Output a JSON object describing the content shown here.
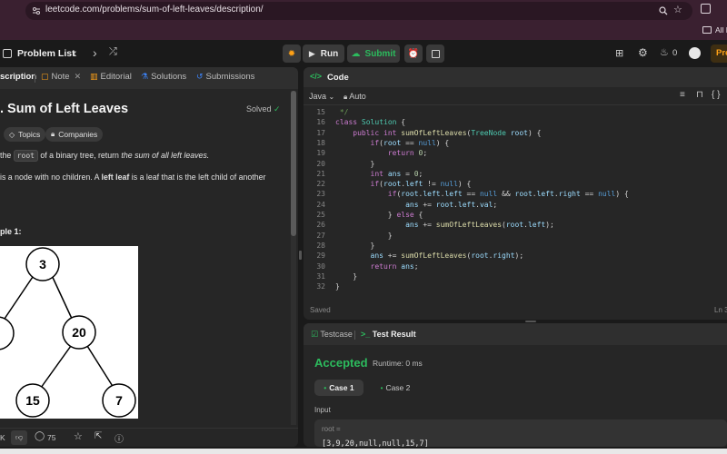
{
  "browser": {
    "url": "leetcode.com/problems/sum-of-left-leaves/description/",
    "bookmarks_label": "All B"
  },
  "nav": {
    "problem_list": "Problem List",
    "run": "Run",
    "submit": "Submit",
    "streak": "0",
    "premium": "Pre"
  },
  "left_tabs": {
    "description": "scription",
    "note": "Note",
    "editorial": "Editorial",
    "solutions": "Solutions",
    "submissions": "Submissions"
  },
  "problem": {
    "title": ". Sum of Left Leaves",
    "status": "Solved",
    "tags": [
      "Topics",
      "Companies"
    ],
    "desc_line1_pre": "the",
    "desc_code": "root",
    "desc_line1_mid": "of a binary tree, return",
    "desc_line1_em": "the sum of all left leaves.",
    "desc_line2_pre": "is a node with no children. A",
    "desc_line2_bold": "left leaf",
    "desc_line2_post": "is a leaf that is the left child of another",
    "example_heading": "ple 1:",
    "tree_nodes": [
      "3",
      "20",
      "15",
      "7"
    ],
    "bottom_bar": {
      "likes": "K",
      "comments": "75"
    }
  },
  "code": {
    "language": "Java",
    "auto": "Auto",
    "header": "Code",
    "saved": "Saved",
    "ln_indicator": "Ln 3",
    "lines": [
      {
        "n": "15",
        "t": " */"
      },
      {
        "n": "16",
        "t": "class Solution {"
      },
      {
        "n": "17",
        "t": "    public int sumOfLeftLeaves(TreeNode root) {"
      },
      {
        "n": "18",
        "t": "        if(root == null) {"
      },
      {
        "n": "19",
        "t": "            return 0;"
      },
      {
        "n": "20",
        "t": "        }"
      },
      {
        "n": "21",
        "t": "        int ans = 0;"
      },
      {
        "n": "22",
        "t": "        if(root.left != null) {"
      },
      {
        "n": "23",
        "t": "            if(root.left.left == null && root.left.right == null) {"
      },
      {
        "n": "24",
        "t": "                ans += root.left.val;"
      },
      {
        "n": "25",
        "t": "            } else {"
      },
      {
        "n": "26",
        "t": "                ans += sumOfLeftLeaves(root.left);"
      },
      {
        "n": "27",
        "t": "            }"
      },
      {
        "n": "28",
        "t": "        }"
      },
      {
        "n": "29",
        "t": "        ans += sumOfLeftLeaves(root.right);"
      },
      {
        "n": "30",
        "t": "        return ans;"
      },
      {
        "n": "31",
        "t": "    }"
      },
      {
        "n": "32",
        "t": "}"
      }
    ]
  },
  "tests": {
    "testcase_tab": "Testcase",
    "result_tab": "Test Result",
    "accepted": "Accepted",
    "runtime": "Runtime: 0 ms",
    "case1": "Case 1",
    "case2": "Case 2",
    "input_label": "Input",
    "root_label": "root =",
    "root_value": "[3,9,20,null,null,15,7]"
  },
  "colors": {
    "accent_green": "#2cbb5d",
    "accent_orange": "#ffa116",
    "link_blue": "#3b82f6"
  }
}
